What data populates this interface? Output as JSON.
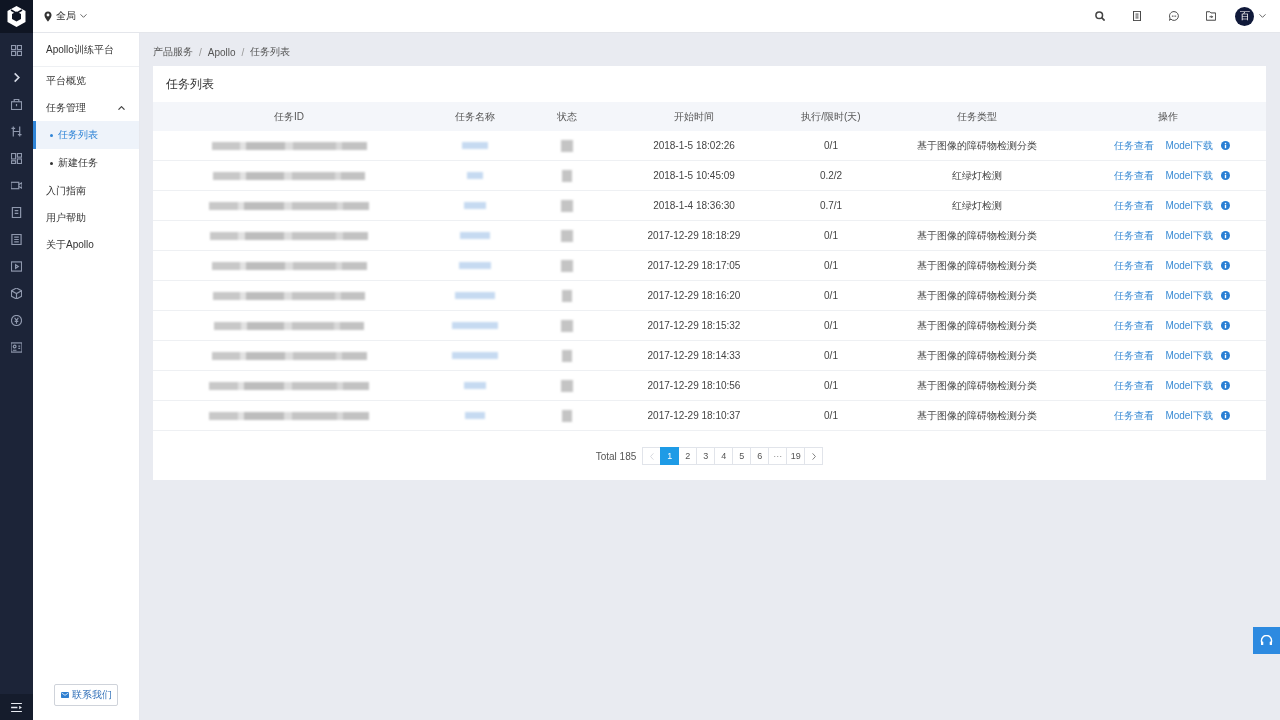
{
  "topbar": {
    "location": "全局",
    "avatar": "百"
  },
  "sidebar": {
    "title": "Apollo训练平台",
    "items": [
      {
        "label": "平台概览",
        "selected": false
      },
      {
        "label": "任务管理",
        "selected": false,
        "expanded": true,
        "children": [
          {
            "label": "任务列表",
            "selected": true
          },
          {
            "label": "新建任务",
            "selected": false
          }
        ]
      },
      {
        "label": "入门指南",
        "selected": false
      },
      {
        "label": "用户帮助",
        "selected": false
      },
      {
        "label": "关于Apollo",
        "selected": false
      }
    ],
    "contact_button": "联系我们"
  },
  "breadcrumb": {
    "items": [
      "产品服务",
      "Apollo",
      "任务列表"
    ],
    "separator": "/"
  },
  "card": {
    "title": "任务列表"
  },
  "table": {
    "columns": [
      "任务ID",
      "任务名称",
      "状态",
      "开始时间",
      "执行/限时(天)",
      "任务类型",
      "操作"
    ],
    "rows": [
      {
        "start_time": "2018-1-5 18:02:26",
        "progress": "0/1",
        "task_type": "基于图像的障碍物检测分类",
        "actions": [
          "任务查看",
          "Model下载"
        ]
      },
      {
        "start_time": "2018-1-5 10:45:09",
        "progress": "0.2/2",
        "task_type": "红绿灯检测",
        "actions": [
          "任务查看",
          "Model下载"
        ]
      },
      {
        "start_time": "2018-1-4 18:36:30",
        "progress": "0.7/1",
        "task_type": "红绿灯检测",
        "actions": [
          "任务查看",
          "Model下载"
        ]
      },
      {
        "start_time": "2017-12-29 18:18:29",
        "progress": "0/1",
        "task_type": "基于图像的障碍物检测分类",
        "actions": [
          "任务查看",
          "Model下载"
        ]
      },
      {
        "start_time": "2017-12-29 18:17:05",
        "progress": "0/1",
        "task_type": "基于图像的障碍物检测分类",
        "actions": [
          "任务查看",
          "Model下载"
        ]
      },
      {
        "start_time": "2017-12-29 18:16:20",
        "progress": "0/1",
        "task_type": "基于图像的障碍物检测分类",
        "actions": [
          "任务查看",
          "Model下载"
        ]
      },
      {
        "start_time": "2017-12-29 18:15:32",
        "progress": "0/1",
        "task_type": "基于图像的障碍物检测分类",
        "actions": [
          "任务查看",
          "Model下载"
        ]
      },
      {
        "start_time": "2017-12-29 18:14:33",
        "progress": "0/1",
        "task_type": "基于图像的障碍物检测分类",
        "actions": [
          "任务查看",
          "Model下载"
        ]
      },
      {
        "start_time": "2017-12-29 18:10:56",
        "progress": "0/1",
        "task_type": "基于图像的障碍物检测分类",
        "actions": [
          "任务查看",
          "Model下载"
        ]
      },
      {
        "start_time": "2017-12-29 18:10:37",
        "progress": "0/1",
        "task_type": "基于图像的障碍物检测分类",
        "actions": [
          "任务查看",
          "Model下载"
        ]
      }
    ]
  },
  "pagination": {
    "total": "Total 185",
    "prev": {
      "disabled": true
    },
    "pages": [
      {
        "label": "1",
        "kind": "page",
        "selected": true
      },
      {
        "label": "2",
        "kind": "page",
        "selected": false
      },
      {
        "label": "3",
        "kind": "page",
        "selected": false
      },
      {
        "label": "4",
        "kind": "page",
        "selected": false
      },
      {
        "label": "5",
        "kind": "page",
        "selected": false
      },
      {
        "label": "6",
        "kind": "page",
        "selected": false
      },
      {
        "label": "···",
        "kind": "ellipsis",
        "selected": false
      },
      {
        "label": "19",
        "kind": "page",
        "selected": false
      }
    ],
    "next": {
      "disabled": false
    }
  }
}
